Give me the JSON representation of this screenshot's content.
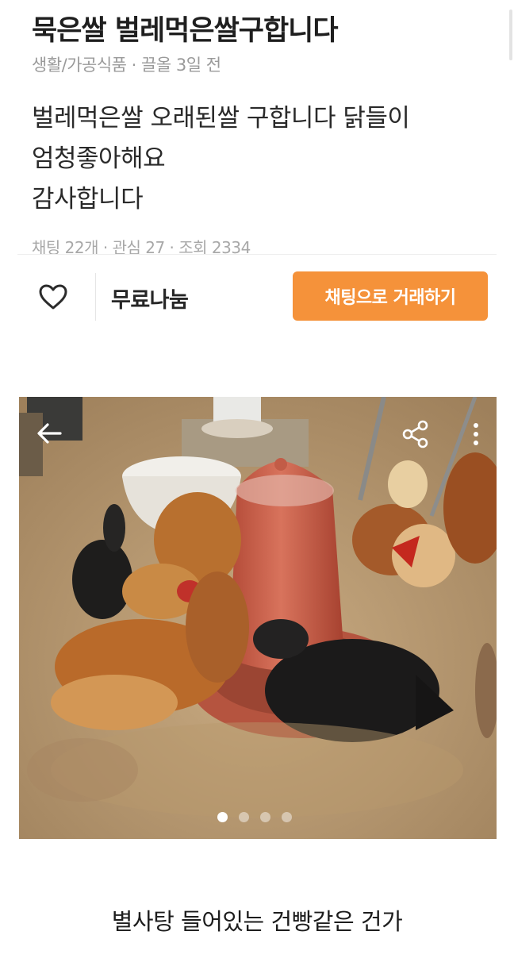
{
  "post": {
    "title": "묵은쌀 벌레먹은쌀구합니다",
    "meta": "생활/가공식품 · 끌올 3일 전",
    "body_lines": [
      "벌레먹은쌀 오래된쌀 구합니다 닭들이",
      "엄청좋아해요",
      "감사합니다"
    ],
    "stats": "채팅 22개 · 관심 27 · 조회 2334"
  },
  "action_bar": {
    "like_icon": "heart-outline",
    "price": "무료나눔",
    "chat_button": "채팅으로 거래하기",
    "chat_button_color": "#f5923a"
  },
  "photo": {
    "back_icon": "arrow-left",
    "share_icon": "share",
    "more_icon": "more-vertical",
    "page_count": 4,
    "current_page": 1
  },
  "caption": "별사탕 들어있는 건빵같은 건가"
}
